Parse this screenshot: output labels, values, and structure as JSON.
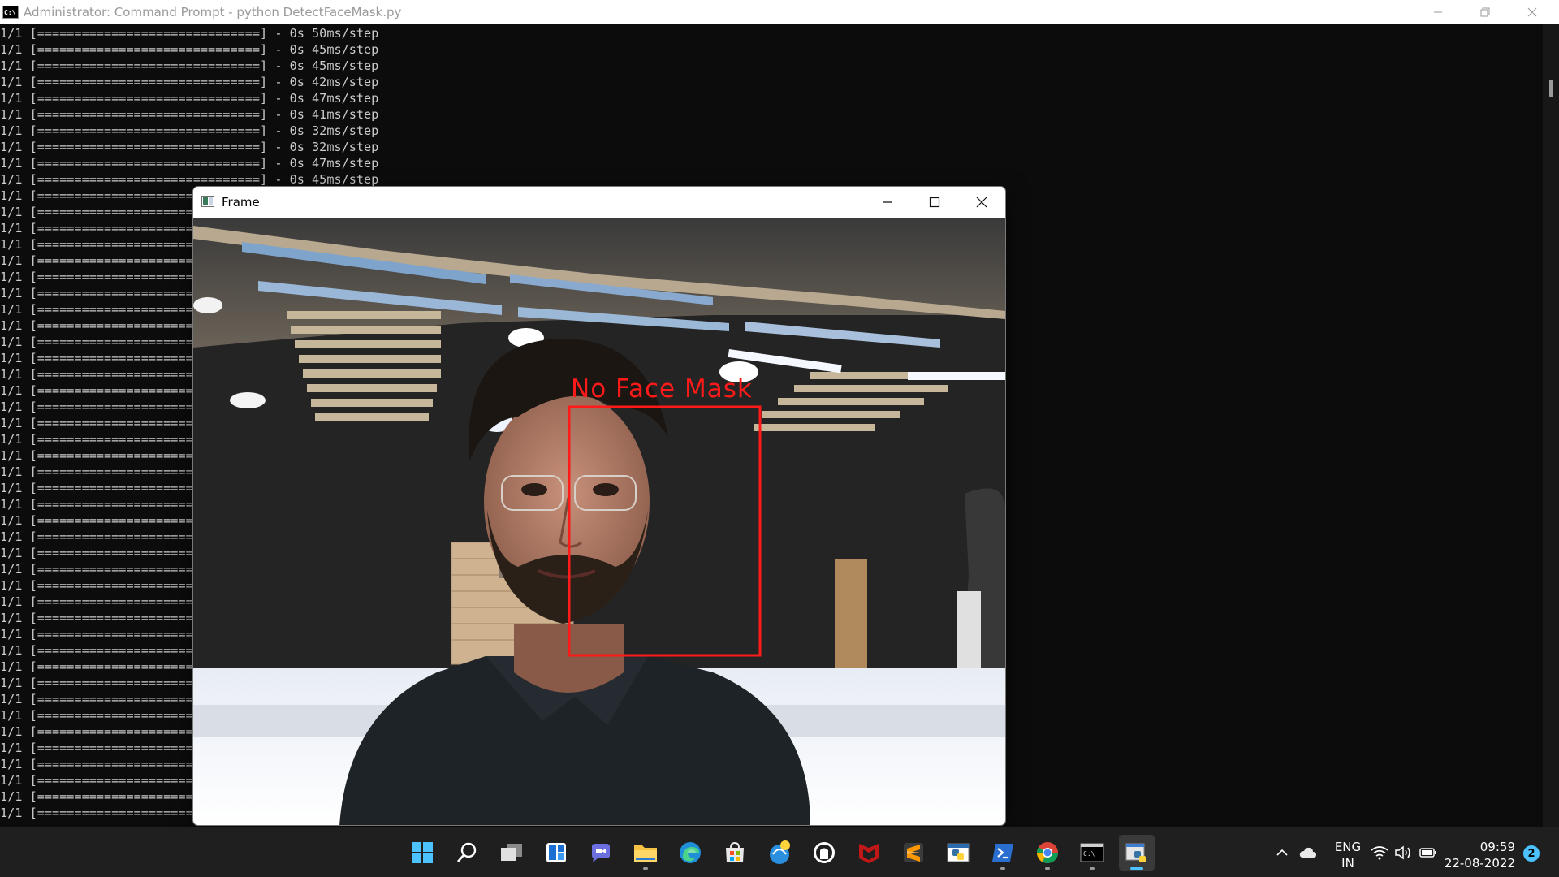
{
  "cmd_window": {
    "icon_label": "C:\\",
    "title": "Administrator: Command Prompt - python  DetectFaceMask.py",
    "controls": {
      "minimize": "—",
      "restore": "❐",
      "close": "✕"
    }
  },
  "console": {
    "full_lines": [
      "1/1 [==============================] - 0s 50ms/step",
      "1/1 [==============================] - 0s 45ms/step",
      "1/1 [==============================] - 0s 45ms/step",
      "1/1 [==============================] - 0s 42ms/step",
      "1/1 [==============================] - 0s 47ms/step",
      "1/1 [==============================] - 0s 41ms/step",
      "1/1 [==============================] - 0s 32ms/step",
      "1/1 [==============================] - 0s 32ms/step",
      "1/1 [==============================] - 0s 47ms/step",
      "1/1 [==============================] - 0s 45ms/step"
    ],
    "partial_line": "1/1 [==============================",
    "partial_count": 39
  },
  "frame_window": {
    "title": "Frame",
    "detection_label": "No Face Mask",
    "box_color": "#ff1a1a"
  },
  "taskbar": {
    "apps": [
      {
        "name": "start-icon"
      },
      {
        "name": "search-icon"
      },
      {
        "name": "task-view-icon"
      },
      {
        "name": "widgets-icon"
      },
      {
        "name": "teams-chat-icon"
      },
      {
        "name": "file-explorer-icon"
      },
      {
        "name": "edge-icon"
      },
      {
        "name": "microsoft-store-icon"
      },
      {
        "name": "python-idle-icon"
      },
      {
        "name": "github-icon"
      },
      {
        "name": "mcafee-icon"
      },
      {
        "name": "sublime-text-icon"
      },
      {
        "name": "python-app-icon"
      },
      {
        "name": "powershell-icon"
      },
      {
        "name": "chrome-icon"
      },
      {
        "name": "terminal-icon"
      },
      {
        "name": "python-running-icon"
      }
    ],
    "tray": {
      "language_line1": "ENG",
      "language_line2": "IN",
      "time": "09:59",
      "date": "22-08-2022",
      "notification_count": "2"
    }
  }
}
